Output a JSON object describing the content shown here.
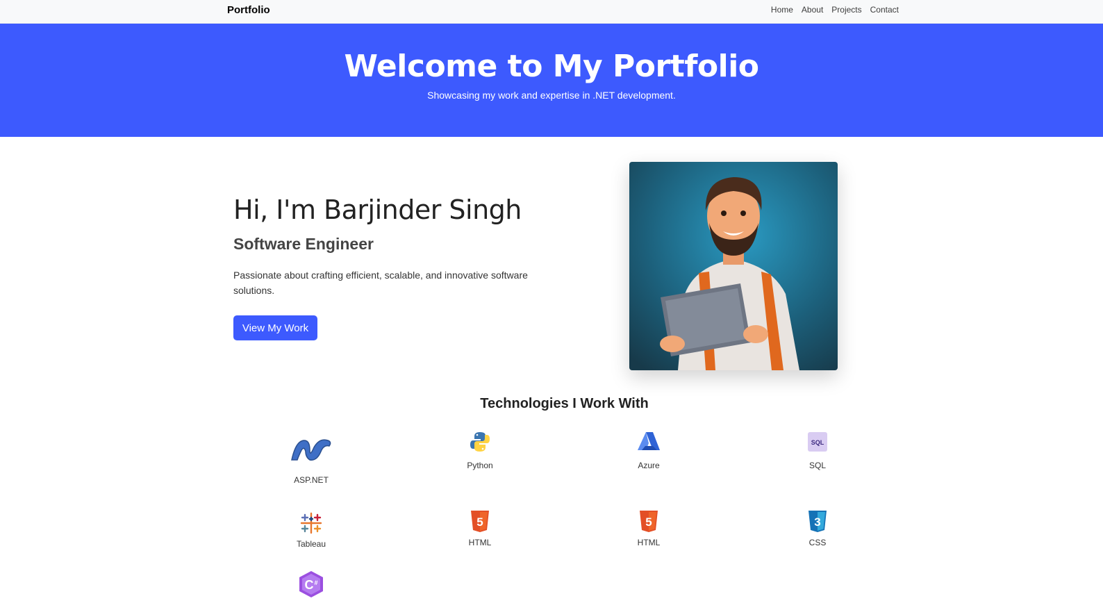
{
  "navbar": {
    "brand": "Portfolio",
    "links": [
      "Home",
      "About",
      "Projects",
      "Contact"
    ]
  },
  "hero": {
    "title": "Welcome to My Portfolio",
    "subtitle": "Showcasing my work and expertise in .NET development."
  },
  "intro": {
    "greeting": "Hi, I'm Barjinder Singh",
    "role": "Software Engineer",
    "description": "Passionate about crafting efficient, scalable, and innovative software solutions.",
    "cta_label": "View My Work"
  },
  "technologies": {
    "title": "Technologies I Work With",
    "items": [
      {
        "label": "ASP.NET",
        "icon": "dotnet-icon"
      },
      {
        "label": "Python",
        "icon": "python-icon"
      },
      {
        "label": "Azure",
        "icon": "azure-icon"
      },
      {
        "label": "SQL",
        "icon": "sql-icon"
      },
      {
        "label": "Tableau",
        "icon": "tableau-icon"
      },
      {
        "label": "HTML",
        "icon": "html5-icon"
      },
      {
        "label": "HTML",
        "icon": "html5-icon"
      },
      {
        "label": "CSS",
        "icon": "css3-icon"
      },
      {
        "label": "",
        "icon": "csharp-icon"
      }
    ]
  },
  "colors": {
    "accent": "#3d5afe",
    "navbar_bg": "#f8f9fa"
  }
}
